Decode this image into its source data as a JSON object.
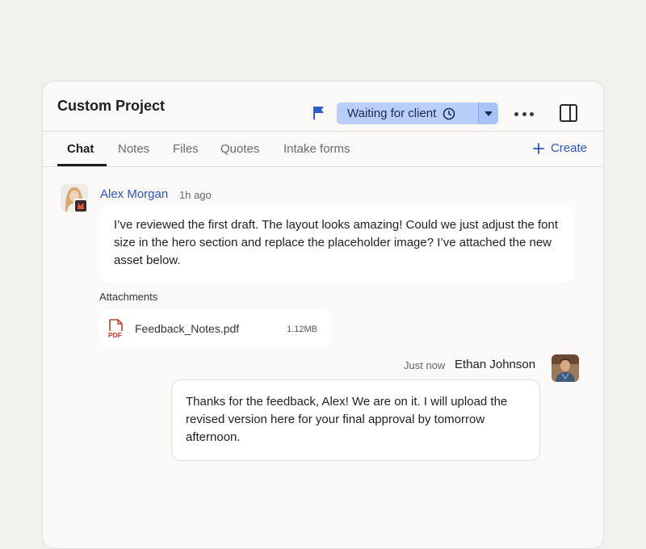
{
  "project": {
    "title": "Custom Project"
  },
  "status": {
    "label": "Waiting for client"
  },
  "icons": {
    "flag": "flag-icon",
    "clock": "clock-icon",
    "caret": "chevron-down-icon",
    "more": "more-horizontal-icon",
    "panel": "side-panel-icon",
    "plus": "plus-icon",
    "pdf": "pdf-file-icon"
  },
  "colors": {
    "accent": "#2b57b8",
    "status_bg": "#b9cffa",
    "flag": "#2f5fc4",
    "pdf": "#c43b2f"
  },
  "tabs": [
    {
      "label": "Chat",
      "active": true
    },
    {
      "label": "Notes"
    },
    {
      "label": "Files"
    },
    {
      "label": "Quotes"
    },
    {
      "label": "Intake forms"
    }
  ],
  "create_label": "Create",
  "messages": [
    {
      "sender": "Alex Morgan",
      "time": "1h ago",
      "text": "I’ve reviewed the first draft. The layout looks amazing! Could we just adjust the font size in the hero section and replace the placeholder image? I’ve attached the new asset below."
    },
    {
      "sender": "Ethan Johnson",
      "time": "Just now",
      "text": "Thanks for the feedback, Alex! We are on it. I will upload the revised version here for your final approval by tomorrow afternoon."
    }
  ],
  "attachments": {
    "label": "Attachments",
    "files": [
      {
        "name": "Feedback_Notes.pdf",
        "size": "1.12MB",
        "type_label": "PDF"
      }
    ]
  }
}
